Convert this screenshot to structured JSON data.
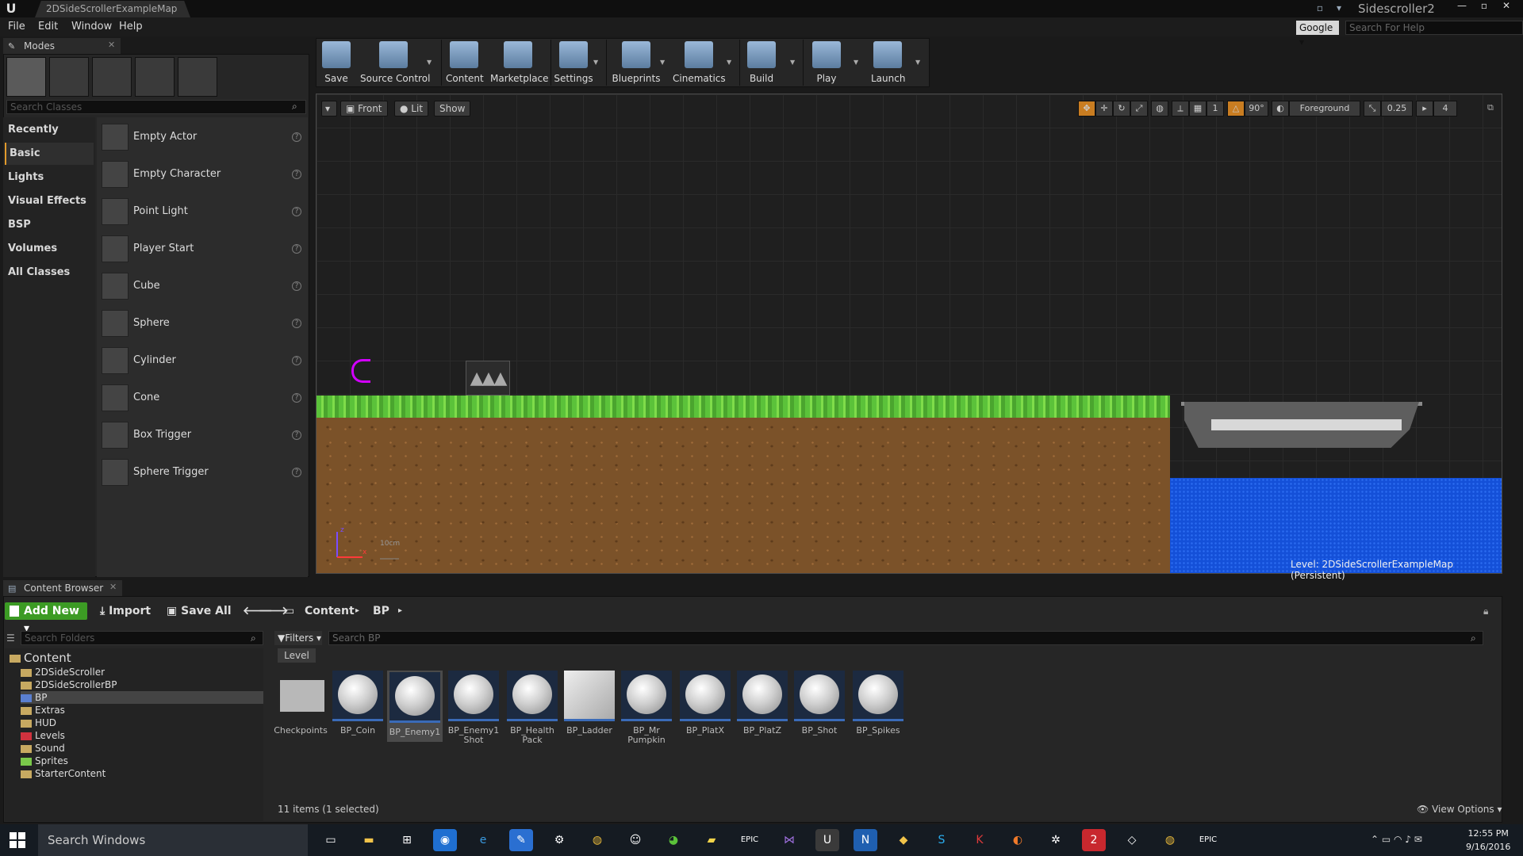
{
  "window": {
    "tab_title": "2DSideScrollerExampleMap",
    "project_name": "Sidescroller2"
  },
  "menu": [
    "File",
    "Edit",
    "Window",
    "Help"
  ],
  "help_search": {
    "engine": "Google",
    "placeholder": "Search For Help"
  },
  "modes": {
    "tab_label": "Modes",
    "search_placeholder": "Search Classes",
    "categories": [
      "Recently Placed",
      "Basic",
      "Lights",
      "Visual Effects",
      "BSP",
      "Volumes",
      "All Classes"
    ],
    "active_category": "Basic",
    "items": [
      "Empty Actor",
      "Empty Character",
      "Point Light",
      "Player Start",
      "Cube",
      "Sphere",
      "Cylinder",
      "Cone",
      "Box Trigger",
      "Sphere Trigger"
    ]
  },
  "toolbar": {
    "tools": [
      "Save",
      "Source Control",
      "Content",
      "Marketplace",
      "Settings",
      "Blueprints",
      "Cinematics",
      "Build",
      "Play",
      "Launch"
    ]
  },
  "viewport": {
    "view_mode": "Front",
    "lighting": "Lit",
    "show_label": "Show",
    "angle": "90°",
    "layer": "Foreground",
    "scale": "0.25",
    "camera_speed": "4",
    "grid_count": "1",
    "scale_label": "10cm",
    "level_text": "Level:  2DSideScrollerExampleMap (Persistent)"
  },
  "content_browser": {
    "tab_label": "Content Browser",
    "add_new": "Add New",
    "import": "Import",
    "save_all": "Save All",
    "breadcrumb": [
      "Content",
      "BP"
    ],
    "search_folders_placeholder": "Search Folders",
    "filters_label": "Filters",
    "search_placeholder": "Search BP",
    "filter_chip": "Level",
    "tree": [
      {
        "name": "Content",
        "color": "#c7a961"
      },
      {
        "name": "2DSideScroller",
        "color": "#c7a961"
      },
      {
        "name": "2DSideScrollerBP",
        "color": "#c7a961"
      },
      {
        "name": "BP",
        "color": "#5a7fd0"
      },
      {
        "name": "Extras",
        "color": "#c7a961"
      },
      {
        "name": "HUD",
        "color": "#c7a961"
      },
      {
        "name": "Levels",
        "color": "#d0323e"
      },
      {
        "name": "Sound",
        "color": "#c7a961"
      },
      {
        "name": "Sprites",
        "color": "#7ac84a"
      },
      {
        "name": "StarterContent",
        "color": "#c7a961"
      }
    ],
    "assets": [
      "Checkpoints",
      "BP_Coin",
      "BP_Enemy1",
      "BP_Enemy1 Shot",
      "BP_Health Pack",
      "BP_Ladder",
      "BP_Mr Pumpkin",
      "BP_PlatX",
      "BP_PlatZ",
      "BP_Shot",
      "BP_Spikes"
    ],
    "selected_asset": "BP_Enemy1",
    "status": "11 items (1 selected)",
    "view_options": "View Options"
  },
  "taskbar": {
    "search_placeholder": "Search Windows",
    "time": "12:55 PM",
    "date": "9/16/2016"
  }
}
